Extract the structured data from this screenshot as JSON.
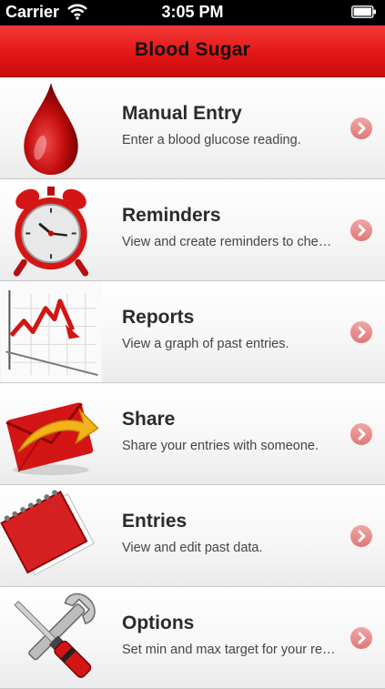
{
  "status": {
    "carrier": "Carrier",
    "time": "3:05 PM"
  },
  "navbar": {
    "title": "Blood Sugar"
  },
  "menu": [
    {
      "title": "Manual Entry",
      "subtitle": "Enter a blood glucose reading.",
      "icon": "blood-drop-icon"
    },
    {
      "title": "Reminders",
      "subtitle": "View and create reminders to check your blood sugar.",
      "icon": "alarm-clock-icon"
    },
    {
      "title": "Reports",
      "subtitle": "View a graph of past entries.",
      "icon": "line-graph-icon"
    },
    {
      "title": "Share",
      "subtitle": "Share your entries with someone.",
      "icon": "envelope-icon"
    },
    {
      "title": "Entries",
      "subtitle": "View and edit past data.",
      "icon": "notebook-icon"
    },
    {
      "title": "Options",
      "subtitle": "Set min and max target for your readings.",
      "icon": "tools-icon"
    }
  ],
  "colors": {
    "nav_red": "#e31616",
    "disclosure": "#e07777"
  }
}
